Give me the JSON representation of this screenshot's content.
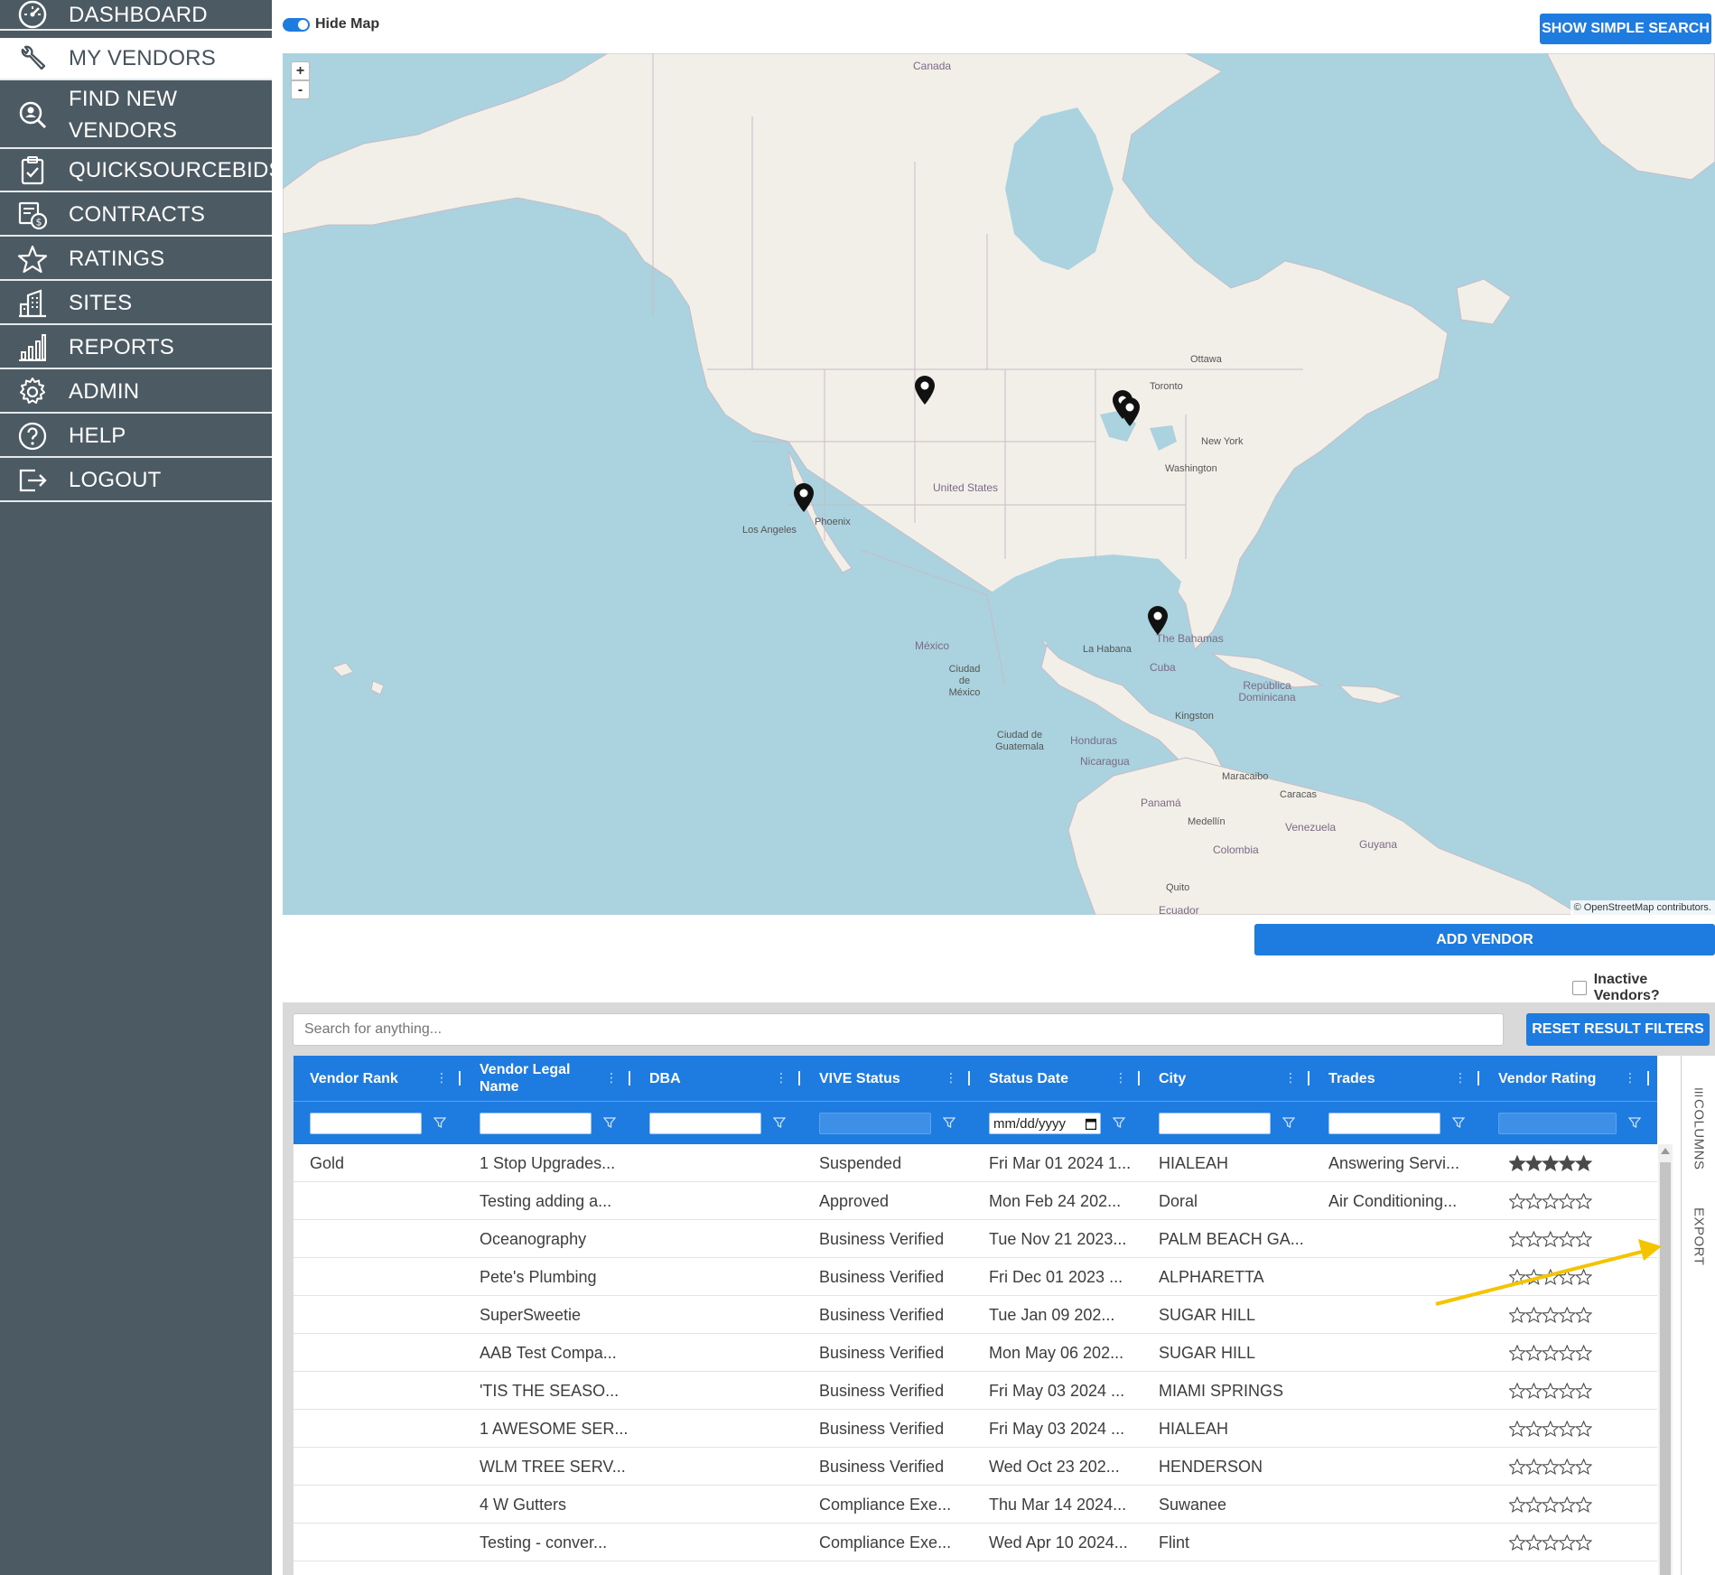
{
  "nav": {
    "items": [
      {
        "label": "DASHBOARD",
        "icon": "dashboard-gauge-icon"
      },
      {
        "label": "MY VENDORS",
        "icon": "wrench-icon"
      },
      {
        "label": "FIND NEW VENDORS",
        "icon": "search-user-icon"
      },
      {
        "label": "QUICKSOURCEBIDS",
        "icon": "clipboard-check-icon"
      },
      {
        "label": "CONTRACTS",
        "icon": "contract-dollar-icon"
      },
      {
        "label": "RATINGS",
        "icon": "star-icon"
      },
      {
        "label": "SITES",
        "icon": "building-icon"
      },
      {
        "label": "REPORTS",
        "icon": "bar-chart-icon"
      },
      {
        "label": "ADMIN",
        "icon": "gear-icon"
      },
      {
        "label": "HELP",
        "icon": "question-circle-icon"
      },
      {
        "label": "LOGOUT",
        "icon": "logout-icon"
      }
    ],
    "active_index": 1
  },
  "top": {
    "hide_map_label": "Hide Map",
    "simple_search_label": "SHOW SIMPLE SEARCH"
  },
  "map": {
    "zoom_in": "+",
    "zoom_out": "-",
    "attribution": "© OpenStreetMap contributors.",
    "places": {
      "canada": "Canada",
      "ottawa": "Ottawa",
      "toronto": "Toronto",
      "new_york": "New York",
      "washington": "Washington",
      "united_states": "United States",
      "phoenix": "Phoenix",
      "los_angeles": "Los Angeles",
      "mexico": "México",
      "ciudad_mexico": "Ciudad de México",
      "la_habana": "La Habana",
      "the_bahamas": "The Bahamas",
      "cuba": "Cuba",
      "republica_dominicana": "República Dominicana",
      "kingston": "Kingston",
      "ciudad_guatemala": "Ciudad de Guatemala",
      "honduras": "Honduras",
      "nicaragua": "Nicaragua",
      "panama": "Panamá",
      "maracaibo": "Maracaibo",
      "caracas": "Caracas",
      "venezuela": "Venezuela",
      "guyana": "Guyana",
      "medellin": "Medellín",
      "colombia": "Colombia",
      "quito": "Quito",
      "ecuador": "Ecuador"
    }
  },
  "actions": {
    "add_vendor_label": "ADD VENDOR",
    "inactive_vendors_label": "Inactive Vendors?"
  },
  "grid": {
    "search_placeholder": "Search for anything...",
    "reset_filters_label": "RESET RESULT FILTERS",
    "columns": [
      "Vendor Rank",
      "Vendor Legal Name",
      "DBA",
      "VIVE Status",
      "Status Date",
      "City",
      "Trades",
      "Vendor Rating"
    ],
    "status_date_placeholder": "mm/dd/yyyy",
    "side_tabs": {
      "columns": "COLUMNS",
      "export": "EXPORT"
    },
    "rows": [
      {
        "rank": "Gold",
        "name": "1 Stop Upgrades...",
        "dba": "",
        "status": "Suspended",
        "date": "Fri Mar 01 2024 1...",
        "city": "HIALEAH",
        "trades": "Answering Servi...",
        "rating": 5
      },
      {
        "rank": "",
        "name": "Testing adding a...",
        "dba": "",
        "status": "Approved",
        "date": "Mon Feb 24 202...",
        "city": "Doral",
        "trades": "Air Conditioning...",
        "rating": 0
      },
      {
        "rank": "",
        "name": "Oceanography",
        "dba": "",
        "status": "Business Verified",
        "date": "Tue Nov 21 2023...",
        "city": "PALM BEACH GA...",
        "trades": "",
        "rating": 0
      },
      {
        "rank": "",
        "name": "Pete's Plumbing",
        "dba": "",
        "status": "Business Verified",
        "date": "Fri Dec 01 2023 ...",
        "city": "ALPHARETTA",
        "trades": "",
        "rating": 0
      },
      {
        "rank": "",
        "name": "SuperSweetie",
        "dba": "",
        "status": "Business Verified",
        "date": "Tue Jan 09 202...",
        "city": "SUGAR HILL",
        "trades": "",
        "rating": 0
      },
      {
        "rank": "",
        "name": "AAB Test Compa...",
        "dba": "",
        "status": "Business Verified",
        "date": "Mon May 06 202...",
        "city": "SUGAR HILL",
        "trades": "",
        "rating": 0
      },
      {
        "rank": "",
        "name": "'TIS THE SEASO...",
        "dba": "",
        "status": "Business Verified",
        "date": "Fri May 03 2024 ...",
        "city": "MIAMI SPRINGS",
        "trades": "",
        "rating": 0
      },
      {
        "rank": "",
        "name": "1 AWESOME SER...",
        "dba": "",
        "status": "Business Verified",
        "date": "Fri May 03 2024 ...",
        "city": "HIALEAH",
        "trades": "",
        "rating": 0
      },
      {
        "rank": "",
        "name": "WLM TREE SERV...",
        "dba": "",
        "status": "Business Verified",
        "date": "Wed Oct 23 202...",
        "city": "HENDERSON",
        "trades": "",
        "rating": 0
      },
      {
        "rank": "",
        "name": "4 W Gutters",
        "dba": "",
        "status": "Compliance Exe...",
        "date": "Thu Mar 14 2024...",
        "city": "Suwanee",
        "trades": "",
        "rating": 0
      },
      {
        "rank": "",
        "name": "Testing - conver...",
        "dba": "",
        "status": "Compliance Exe...",
        "date": "Wed Apr 10 2024...",
        "city": "Flint",
        "trades": "",
        "rating": 0
      }
    ]
  },
  "colors": {
    "sidebar_bg": "#4c5a63",
    "accent_blue": "#1e7be0",
    "map_water": "#aad3df",
    "map_land": "#f2efe9",
    "annotation_arrow": "#f5c400"
  }
}
